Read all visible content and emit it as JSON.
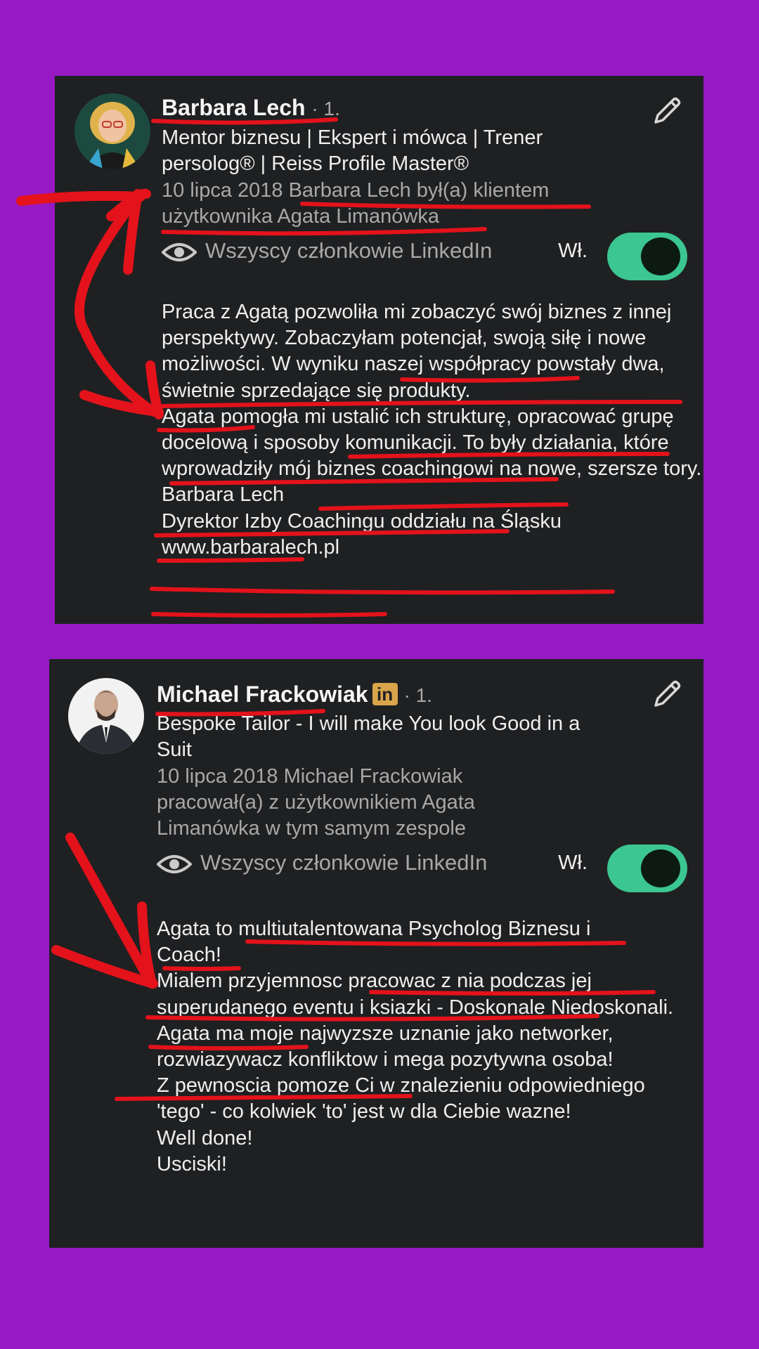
{
  "colors": {
    "background": "#9619c3",
    "card": "#1f2022",
    "toggle_on": "#3cc691",
    "annotation": "#e3121b",
    "badge": "#d9a44a"
  },
  "recommendations": [
    {
      "name": "Barbara Lech",
      "degree": "· 1.",
      "headline": "Mentor biznesu | Ekspert i mówca | Trener persolog® | Reiss Profile Master®",
      "meta": "10 lipca 2018 Barbara Lech był(a) klientem użytkownika Agata Limanówka",
      "visibility_label": "Wszyscy członkowie LinkedIn",
      "toggle_label": "Wł.",
      "toggle_on": true,
      "body": [
        "Praca z Agatą pozwoliła mi zobaczyć swój biznes z innej perspektywy. Zobaczyłam potencjał, swoją siłę i nowe możliwości. W wyniku naszej współpracy powstały dwa, świetnie sprzedające się produkty.",
        "Agata pomogła mi ustalić ich strukturę, opracować grupę docelową i sposoby komunikacji. To były działania, które wprowadziły mój biznes coachingowi na nowe, szersze tory.",
        "Barbara Lech",
        "Dyrektor Izby Coachingu oddziału na Śląsku",
        "www.barbaralech.pl"
      ]
    },
    {
      "name": "Michael Frackowiak",
      "badge": "in",
      "degree": "· 1.",
      "headline": "Bespoke Tailor - I will make You look Good in a Suit",
      "meta": "10 lipca 2018 Michael Frackowiak pracował(a) z użytkownikiem Agata Limanówka w tym samym zespole",
      "visibility_label": "Wszyscy członkowie LinkedIn",
      "toggle_label": "Wł.",
      "toggle_on": true,
      "body": [
        "Agata to multiutalentowana Psycholog Biznesu i Coach!",
        "Mialem przyjemnosc pracowac z nia podczas jej superudanego eventu i ksiazki - Doskonale Niedoskonali.",
        "Agata ma moje najwyzsze uznanie jako networker, rozwiazywacz konfliktow i mega pozytywna osoba!",
        "Z pewnoscia pomoze Ci w znalezieniu odpowiedniego 'tego' - co kolwiek 'to' jest w dla Ciebie wazne!",
        "Well done!",
        "Usciski!"
      ]
    }
  ]
}
